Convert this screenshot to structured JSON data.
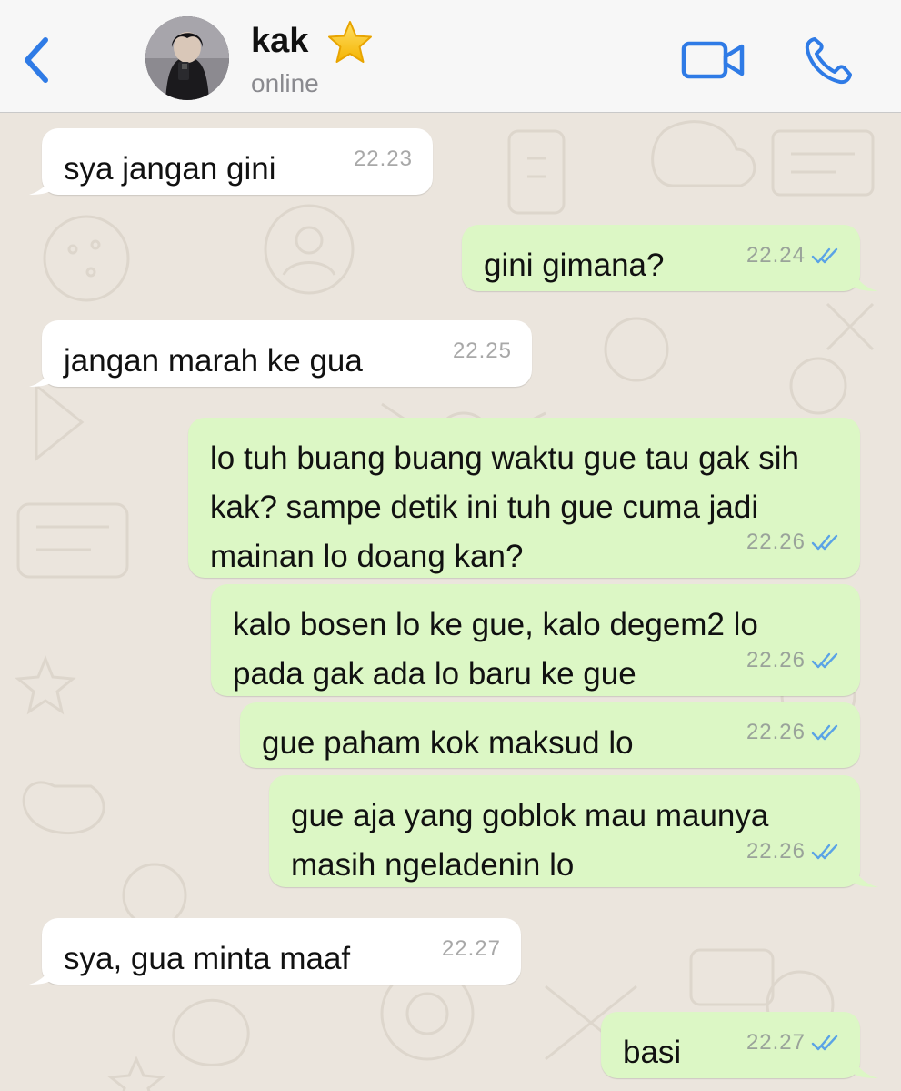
{
  "header": {
    "contact_name": "kak",
    "status": "online",
    "icons": {
      "back": "chevron-left-icon",
      "star": "star-emoji-icon",
      "video": "video-camera-icon",
      "call": "phone-icon"
    }
  },
  "colors": {
    "accent": "#2f7be6",
    "incoming_bubble": "#ffffff",
    "outgoing_bubble": "#dcf7c5",
    "read_ticks": "#5aa3e6"
  },
  "messages": [
    {
      "direction": "in",
      "text": "sya jangan gini",
      "time": "22.23"
    },
    {
      "direction": "out",
      "text": "gini gimana?",
      "time": "22.24",
      "read": true
    },
    {
      "direction": "in",
      "text": "jangan marah ke gua",
      "time": "22.25"
    },
    {
      "direction": "out",
      "text": "lo tuh buang buang waktu gue tau gak sih kak? sampe detik ini tuh gue cuma jadi mainan lo doang kan?",
      "time": "22.26",
      "read": true
    },
    {
      "direction": "out",
      "text": "kalo bosen lo ke gue, kalo degem2 lo pada gak ada lo baru ke gue",
      "time": "22.26",
      "read": true
    },
    {
      "direction": "out",
      "text": "gue paham kok maksud lo",
      "time": "22.26",
      "read": true
    },
    {
      "direction": "out",
      "text": "gue aja yang goblok mau maunya masih ngeladenin lo",
      "time": "22.26",
      "read": true
    },
    {
      "direction": "in",
      "text": "sya, gua minta maaf",
      "time": "22.27"
    },
    {
      "direction": "out",
      "text": "basi",
      "time": "22.27",
      "read": true
    }
  ]
}
